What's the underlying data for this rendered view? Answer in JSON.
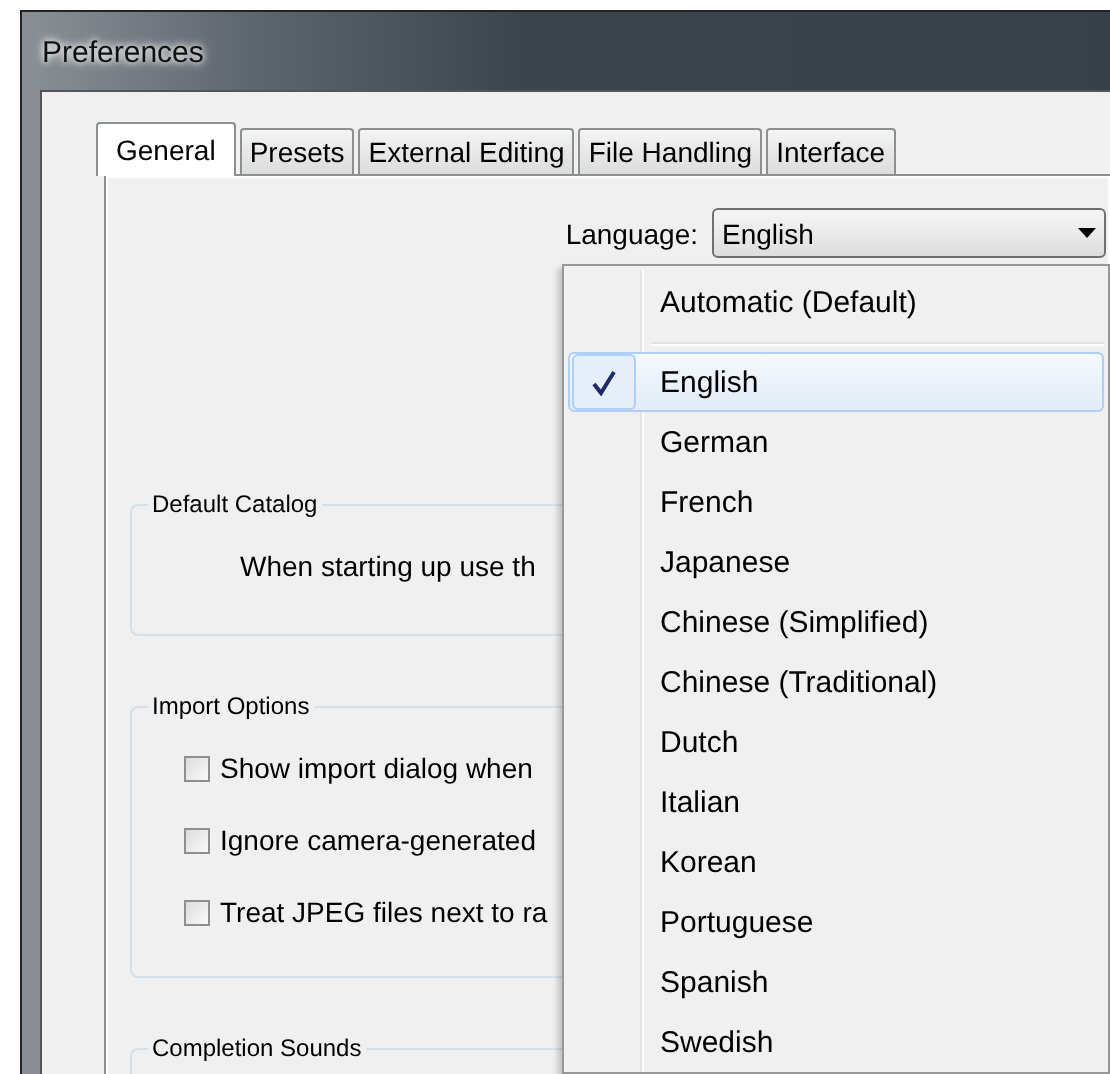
{
  "window": {
    "title": "Preferences"
  },
  "tabs": [
    {
      "label": "General",
      "selected": true
    },
    {
      "label": "Presets",
      "selected": false
    },
    {
      "label": "External Editing",
      "selected": false
    },
    {
      "label": "File Handling",
      "selected": false
    },
    {
      "label": "Interface",
      "selected": false
    }
  ],
  "language": {
    "label": "Language:",
    "value": "English",
    "menu": [
      {
        "kind": "item",
        "label": "Automatic (Default)",
        "selected": false
      },
      {
        "kind": "separator"
      },
      {
        "kind": "item",
        "label": "English",
        "selected": true
      },
      {
        "kind": "item",
        "label": "German",
        "selected": false
      },
      {
        "kind": "item",
        "label": "French",
        "selected": false
      },
      {
        "kind": "item",
        "label": "Japanese",
        "selected": false
      },
      {
        "kind": "item",
        "label": "Chinese (Simplified)",
        "selected": false
      },
      {
        "kind": "item",
        "label": "Chinese (Traditional)",
        "selected": false
      },
      {
        "kind": "item",
        "label": "Dutch",
        "selected": false
      },
      {
        "kind": "item",
        "label": "Italian",
        "selected": false
      },
      {
        "kind": "item",
        "label": "Korean",
        "selected": false
      },
      {
        "kind": "item",
        "label": "Portuguese",
        "selected": false
      },
      {
        "kind": "item",
        "label": "Spanish",
        "selected": false
      },
      {
        "kind": "item",
        "label": "Swedish",
        "selected": false
      }
    ]
  },
  "groups": [
    {
      "title": "Default Catalog",
      "rows": [
        {
          "kind": "text",
          "text": "When starting up use th"
        }
      ]
    },
    {
      "title": "Import Options",
      "rows": [
        {
          "kind": "checkbox",
          "label": "Show import dialog when",
          "checked": false
        },
        {
          "kind": "checkbox",
          "label": "Ignore camera-generated",
          "checked": false
        },
        {
          "kind": "checkbox",
          "label": "Treat JPEG files next to ra",
          "checked": false
        }
      ]
    },
    {
      "title": "Completion Sounds"
    }
  ]
}
